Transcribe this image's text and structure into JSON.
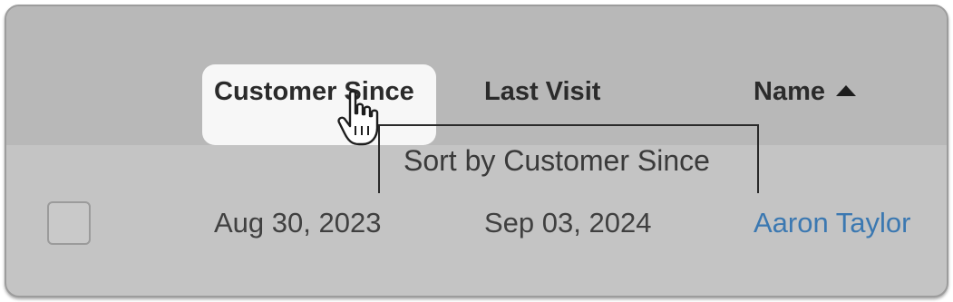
{
  "table": {
    "columns": {
      "customer_since": "Customer Since",
      "last_visit": "Last Visit",
      "name": "Name"
    },
    "sort": {
      "column": "name",
      "direction": "ascending"
    },
    "rows": [
      {
        "customer_since": "Aug 30, 2023",
        "last_visit": "Sep 03, 2024",
        "name": "Aaron Taylor",
        "checked": false
      }
    ]
  },
  "tooltip": {
    "text": "Sort by Customer Since"
  },
  "cursor": {
    "type": "hand-pointer-icon"
  },
  "colors": {
    "panel_background": "#c4c4c4",
    "header_background": "#b8b8b8",
    "hover_highlight": "#f7f7f7",
    "link": "#3b78b1"
  }
}
